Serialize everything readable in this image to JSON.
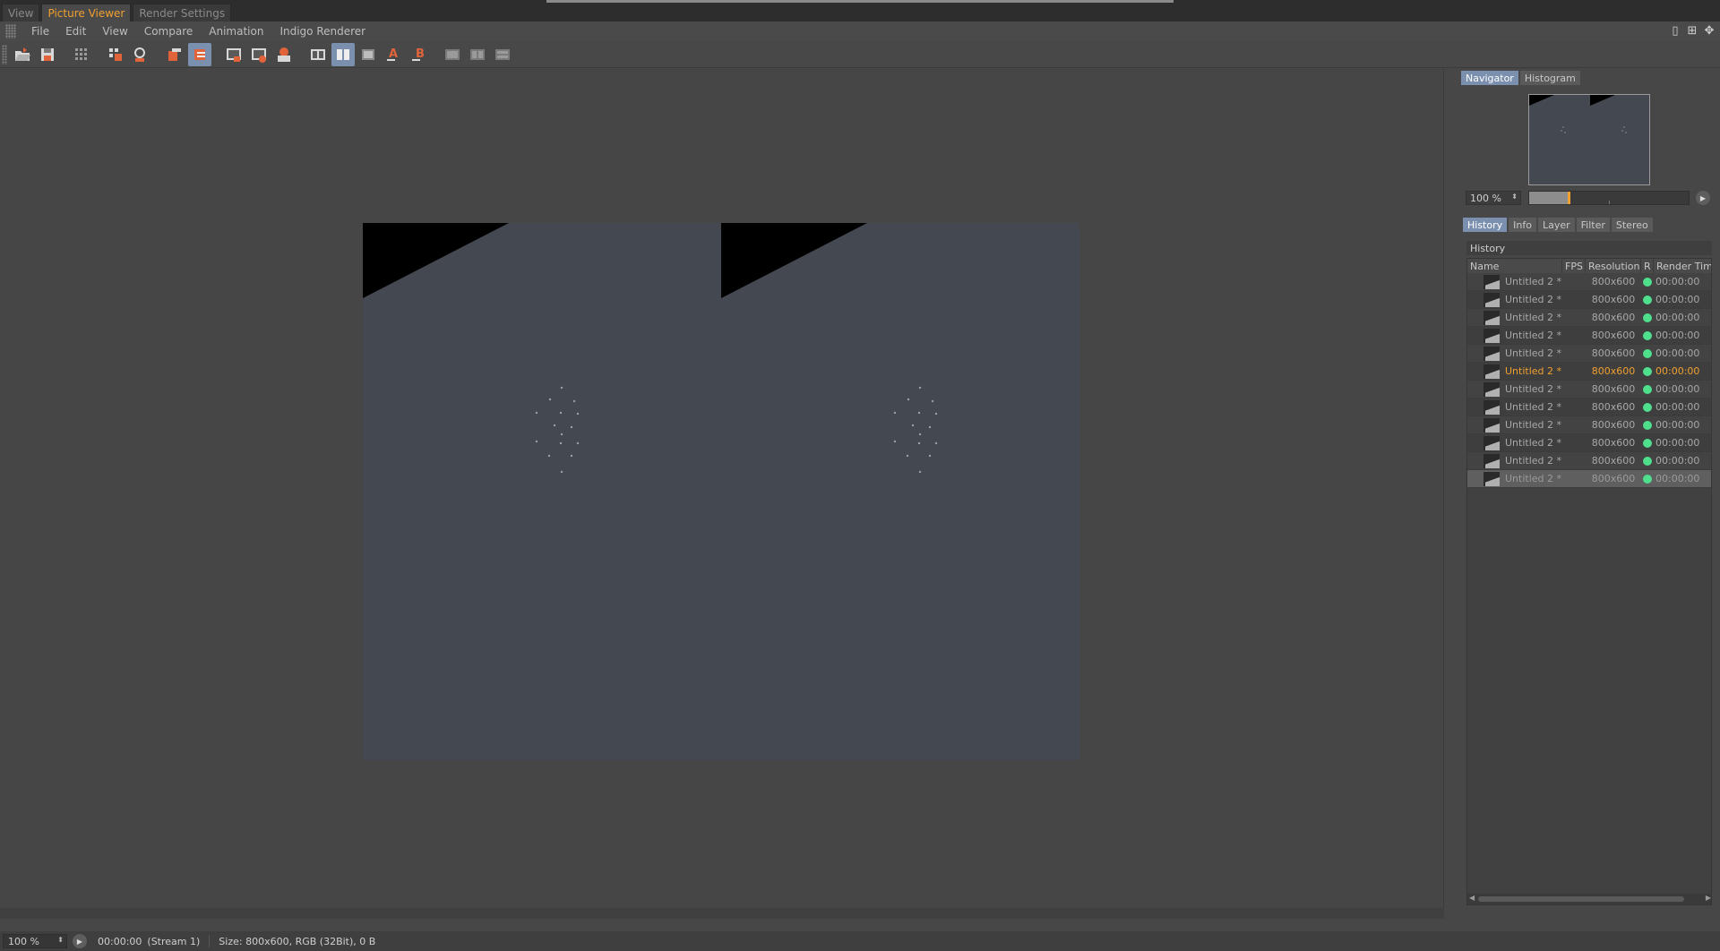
{
  "top_tabs": [
    {
      "label": "View",
      "active": false
    },
    {
      "label": "Picture Viewer",
      "active": true
    },
    {
      "label": "Render Settings",
      "active": false
    }
  ],
  "menu": [
    "File",
    "Edit",
    "View",
    "Compare",
    "Animation",
    "Indigo Renderer"
  ],
  "window_controls": [
    "layout-icon",
    "expand-icon",
    "move-icon"
  ],
  "toolbar": {
    "buttons": [
      {
        "icon": "open-folder-icon"
      },
      {
        "icon": "save-icon"
      },
      {
        "icon": "grid-icon"
      },
      {
        "icon": "region-render-icon"
      },
      {
        "icon": "zoom-icon"
      },
      {
        "icon": "copy-layer-icon"
      },
      {
        "icon": "merge-layer-icon",
        "pressed": true
      },
      {
        "icon": "snapshot-icon"
      },
      {
        "icon": "snapshot-add-icon"
      },
      {
        "icon": "snapshot-compare-icon"
      },
      {
        "icon": "ab-compare-icon"
      },
      {
        "icon": "ab-split-icon",
        "pressed": true
      },
      {
        "icon": "ab-swap-icon"
      },
      {
        "icon": "set-a-icon"
      },
      {
        "icon": "set-b-icon"
      },
      {
        "icon": "ab-text-icon"
      },
      {
        "icon": "ab-view-icon"
      },
      {
        "icon": "ab-layout-icon"
      }
    ],
    "set_a_text": "A",
    "set_b_text": "B",
    "accent": "#e0633a"
  },
  "navigator": {
    "tabs": [
      {
        "label": "Navigator",
        "active": true
      },
      {
        "label": "Histogram",
        "active": false
      }
    ],
    "zoom": "100 %"
  },
  "history_tabs": [
    {
      "label": "History",
      "active": true
    },
    {
      "label": "Info",
      "active": false
    },
    {
      "label": "Layer",
      "active": false
    },
    {
      "label": "Filter",
      "active": false
    },
    {
      "label": "Stereo",
      "active": false
    }
  ],
  "history": {
    "title": "History",
    "columns": [
      "Name",
      "FPS",
      "Resolution",
      "R",
      "Render Tim"
    ],
    "rows": [
      {
        "name": "Untitled 2 *",
        "fps": "",
        "resolution": "800x600",
        "time": "00:00:00"
      },
      {
        "name": "Untitled 2 *",
        "fps": "",
        "resolution": "800x600",
        "time": "00:00:00"
      },
      {
        "name": "Untitled 2 *",
        "fps": "",
        "resolution": "800x600",
        "time": "00:00:00"
      },
      {
        "name": "Untitled 2 *",
        "fps": "",
        "resolution": "800x600",
        "time": "00:00:00"
      },
      {
        "name": "Untitled 2 *",
        "fps": "",
        "resolution": "800x600",
        "time": "00:00:00"
      },
      {
        "name": "Untitled 2 *",
        "fps": "",
        "resolution": "800x600",
        "time": "00:00:00",
        "current": true
      },
      {
        "name": "Untitled 2 *",
        "fps": "",
        "resolution": "800x600",
        "time": "00:00:00"
      },
      {
        "name": "Untitled 2 *",
        "fps": "",
        "resolution": "800x600",
        "time": "00:00:00"
      },
      {
        "name": "Untitled 2 *",
        "fps": "",
        "resolution": "800x600",
        "time": "00:00:00"
      },
      {
        "name": "Untitled 2 *",
        "fps": "",
        "resolution": "800x600",
        "time": "00:00:00"
      },
      {
        "name": "Untitled 2 *",
        "fps": "",
        "resolution": "800x600",
        "time": "00:00:00"
      },
      {
        "name": "Untitled 2 *",
        "fps": "",
        "resolution": "800x600",
        "time": "00:00:00",
        "selected": true
      }
    ],
    "status_color": "#4ee08c",
    "current_color": "#f0a030"
  },
  "statusbar": {
    "zoom": "100 %",
    "time": "00:00:00",
    "stream": "(Stream 1)",
    "info": "Size: 800x600, RGB (32Bit), 0 B"
  },
  "colors": {
    "active_tab_text": "#f0a030",
    "selected_tab_bg": "#7b8fae",
    "render_bg": "#434851"
  }
}
